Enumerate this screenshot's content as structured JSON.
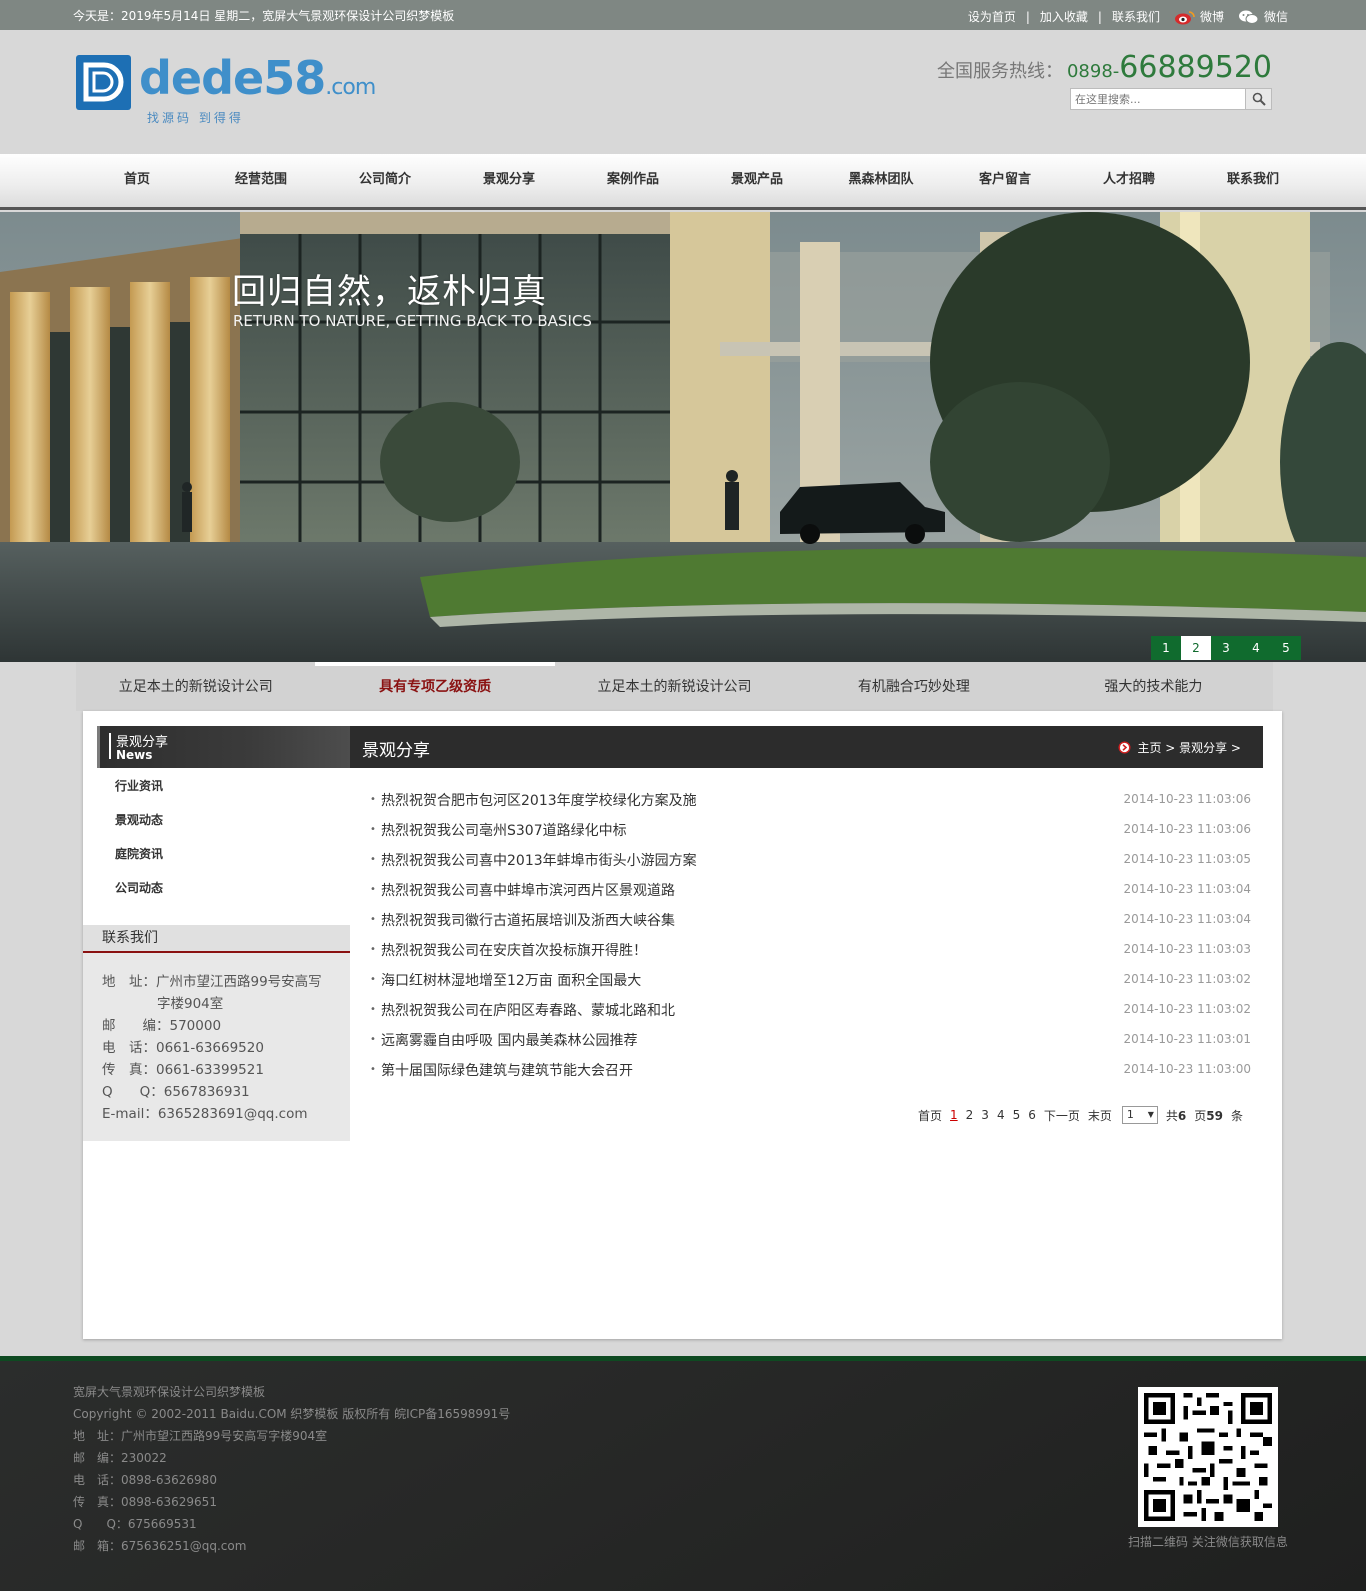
{
  "topbar": {
    "date_text": "今天是：2019年5月14日 星期二，宽屏大气景观环保设计公司织梦模板",
    "links": [
      "设为首页",
      "加入收藏",
      "联系我们"
    ],
    "weibo_label": "微博",
    "wechat_label": "微信"
  },
  "header": {
    "logo_main": "dede58",
    "logo_suffix": ".com",
    "logo_sub": "找源码 到得得",
    "hotline_label": "全国服务热线：",
    "hotline_prefix": "0898-",
    "hotline_number": "66889520",
    "search_placeholder": "在这里搜索..."
  },
  "nav": [
    "首页",
    "经营范围",
    "公司简介",
    "景观分享",
    "案例作品",
    "景观产品",
    "黑森林团队",
    "客户留言",
    "人才招聘",
    "联系我们"
  ],
  "banner": {
    "slogan": "回归自然，返朴归真",
    "slogan_en": "RETURN TO NATURE, GETTING BACK TO BASICS",
    "pages": [
      "1",
      "2",
      "3",
      "4",
      "5"
    ],
    "active_page": "2"
  },
  "feature_tabs": [
    "立足本土的新锐设计公司",
    "具有专项乙级资质",
    "立足本土的新锐设计公司",
    "有机融合巧妙处理",
    "强大的技术能力"
  ],
  "sidebar": {
    "head_title": "景观分享",
    "head_sub": "News",
    "menu": [
      "行业资讯",
      "景观动态",
      "庭院资讯",
      "公司动态"
    ],
    "contact_title": "联系我们",
    "contact": {
      "address_label": "地　址：",
      "address_1": "广州市望江西路99号安高写",
      "address_2": "字楼904室",
      "postcode": "邮　　编：570000",
      "phone": "电　话：0661-63669520",
      "fax": "传　真：0661-63399521",
      "qq": "Q　　Q：6567836931",
      "email": "E-mail：6365283691@qq.com"
    }
  },
  "main": {
    "title": "景观分享",
    "breadcrumb": "主页 > 景观分享 >",
    "items": [
      {
        "title": "热烈祝贺合肥市包河区2013年度学校绿化方案及施",
        "date": "2014-10-23 11:03:06"
      },
      {
        "title": "热烈祝贺我公司亳州S307道路绿化中标",
        "date": "2014-10-23 11:03:06"
      },
      {
        "title": "热烈祝贺我公司喜中2013年蚌埠市街头小游园方案",
        "date": "2014-10-23 11:03:05"
      },
      {
        "title": "热烈祝贺我公司喜中蚌埠市滨河西片区景观道路",
        "date": "2014-10-23 11:03:04"
      },
      {
        "title": "热烈祝贺我司徽行古道拓展培训及浙西大峡谷集",
        "date": "2014-10-23 11:03:04"
      },
      {
        "title": "热烈祝贺我公司在安庆首次投标旗开得胜！",
        "date": "2014-10-23 11:03:03"
      },
      {
        "title": "海口红树林湿地增至12万亩 面积全国最大",
        "date": "2014-10-23 11:03:02"
      },
      {
        "title": "热烈祝贺我公司在庐阳区寿春路、蒙城北路和北",
        "date": "2014-10-23 11:03:02"
      },
      {
        "title": "远离雾霾自由呼吸 国内最美森林公园推荐",
        "date": "2014-10-23 11:03:01"
      },
      {
        "title": "第十届国际绿色建筑与建筑节能大会召开",
        "date": "2014-10-23 11:03:00"
      }
    ],
    "pagination": {
      "first": "首页",
      "current": "1",
      "pages": [
        "2",
        "3",
        "4",
        "5",
        "6"
      ],
      "next": "下一页",
      "last": "末页",
      "select_value": "1",
      "total_prefix": "共",
      "total_pages": "6",
      "total_pages_unit": "页",
      "total_items": "59",
      "total_items_unit": "条"
    }
  },
  "footer": {
    "lines": [
      "宽屏大气景观环保设计公司织梦模板",
      "Copyright © 2002-2011 Baidu.COM 织梦模板 版权所有  皖ICP备16598991号",
      "地　址：广州市望江西路99号安高写字楼904室",
      "邮　编：230022",
      "电　话：0898-63626980",
      "传　真：0898-63629651",
      "Q　　Q：675669531",
      "邮　箱：675636251@qq.com"
    ],
    "qr_caption": "扫描二维码 关注微信获取信息"
  },
  "colors": {
    "brand_green": "#106b2e",
    "accent_red": "#8a1111",
    "logo_blue": "#1d6fb4"
  }
}
